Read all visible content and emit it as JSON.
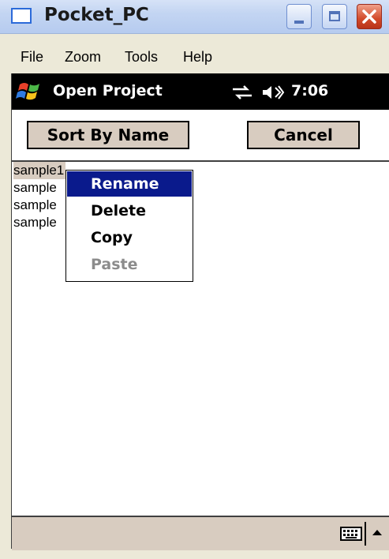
{
  "window": {
    "title": "Pocket_PC",
    "controls": [
      "minimize",
      "maximize",
      "close"
    ]
  },
  "menubar": {
    "items": [
      "File",
      "Zoom",
      "Tools",
      "Help"
    ]
  },
  "navbar": {
    "start_icon": "windows-flag-icon",
    "title": "Open Project",
    "connectivity_icon": "connectivity-icon",
    "volume_icon": "speaker-icon",
    "time": "7:06"
  },
  "toolbar": {
    "sort_label": "Sort By Name",
    "cancel_label": "Cancel"
  },
  "file_list": {
    "items": [
      "sample1",
      "sample",
      "sample",
      "sample"
    ],
    "selected_index": 0
  },
  "context_menu": {
    "items": [
      {
        "label": "Rename",
        "state": "highlighted"
      },
      {
        "label": "Delete",
        "state": "normal"
      },
      {
        "label": "Copy",
        "state": "normal"
      },
      {
        "label": "Paste",
        "state": "disabled"
      }
    ]
  },
  "bottom_bar": {
    "input_icon": "keyboard-icon",
    "sip_toggle_icon": "up-arrow-icon"
  },
  "colors": {
    "titlebar": "#c3d5f2",
    "navbar": "#000000",
    "button_face": "#d8ccc0",
    "menu_highlight": "#0a1a8c",
    "disabled_text": "#8c8c8c"
  }
}
